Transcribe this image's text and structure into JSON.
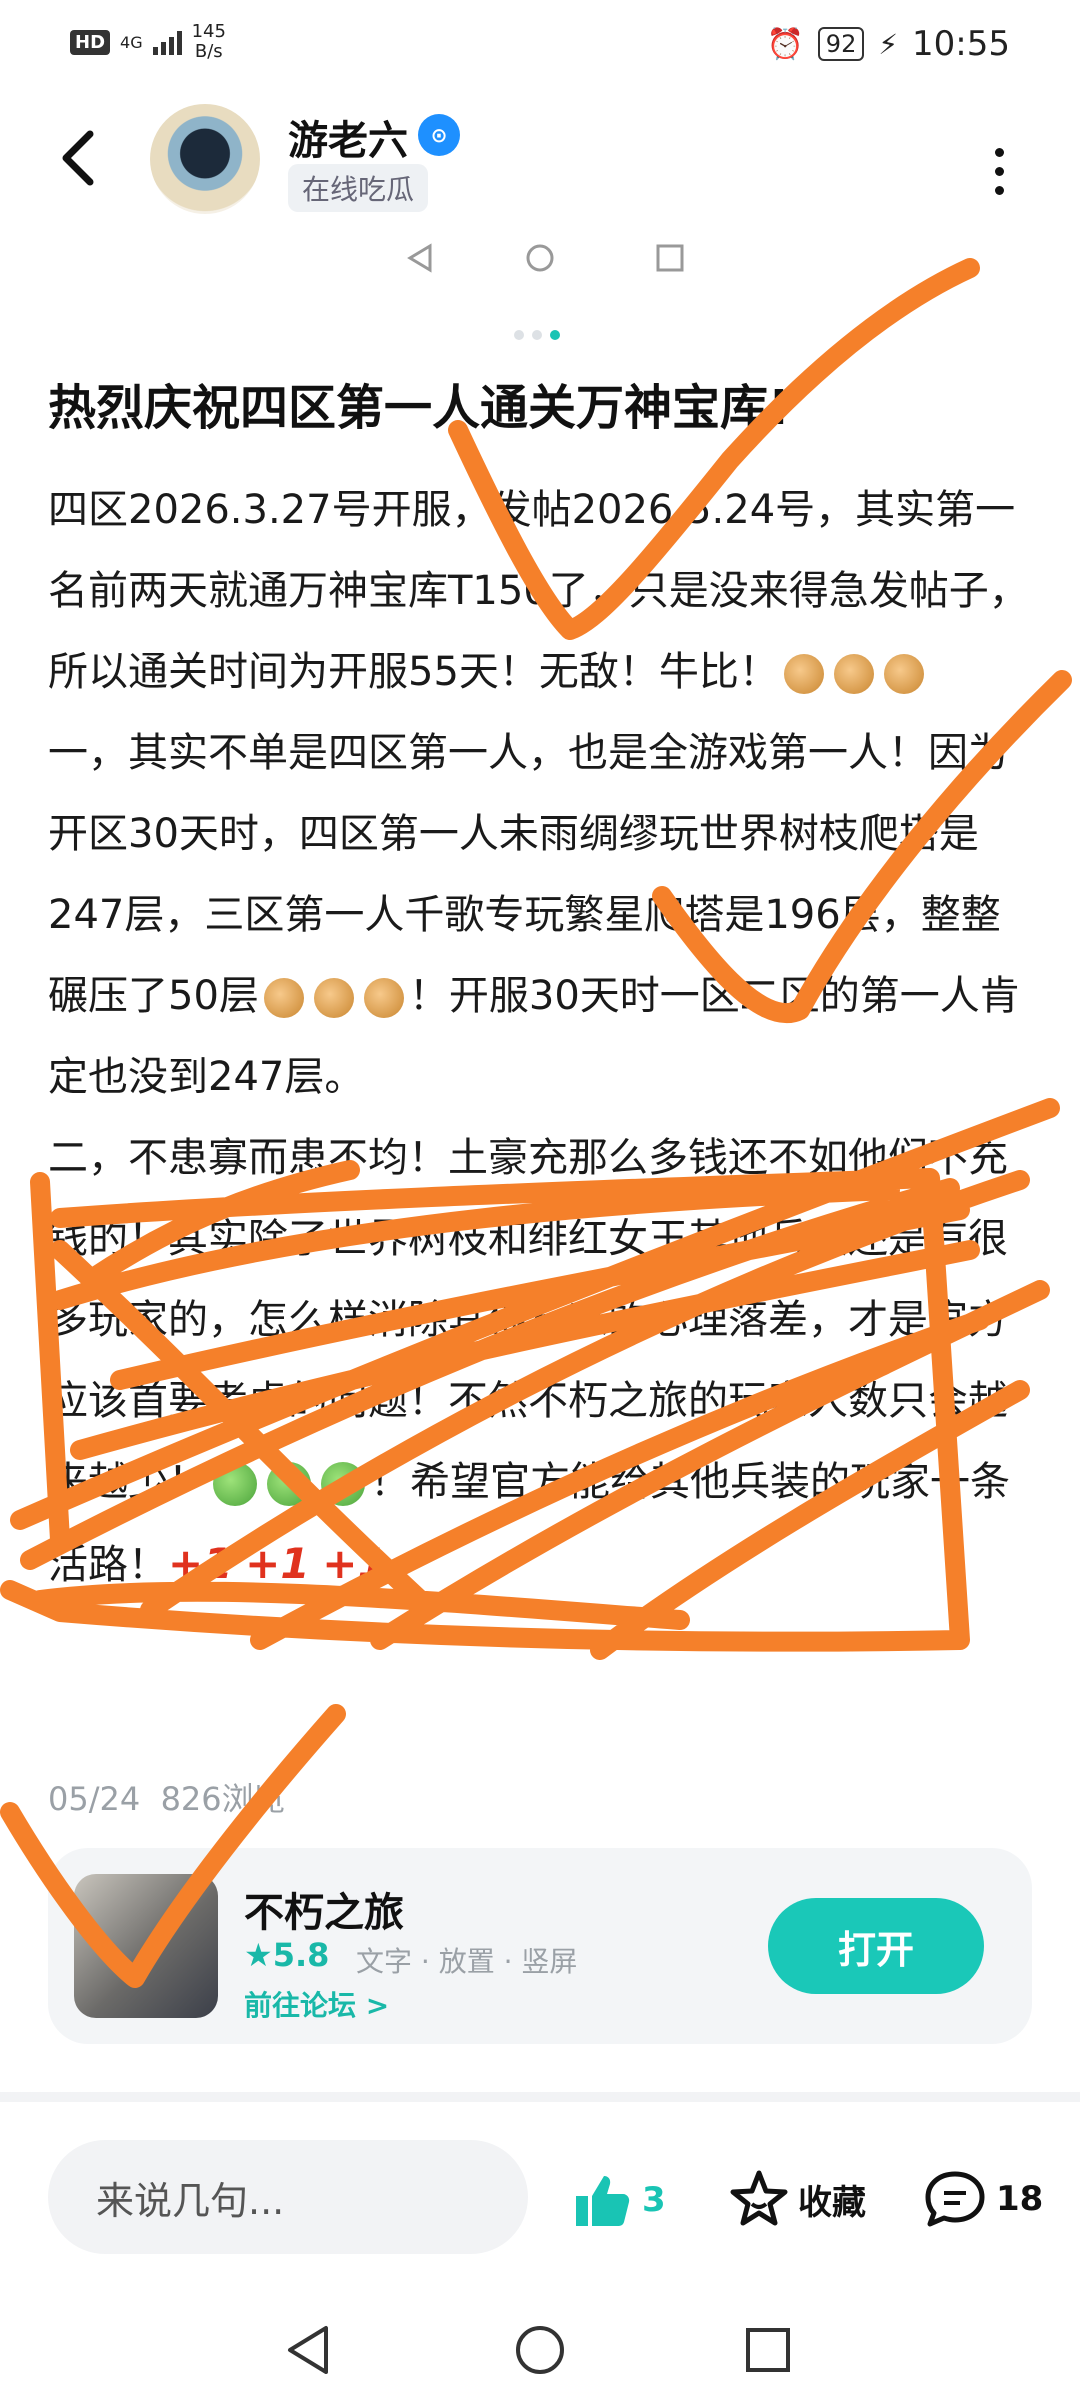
{
  "status_bar": {
    "hd": "HD",
    "network": "4G",
    "speed_value": "145",
    "speed_unit": "B/s",
    "battery": "92",
    "time": "10:55"
  },
  "header": {
    "username": "游老六",
    "user_tag": "在线吃瓜"
  },
  "post": {
    "title": "热烈庆祝四区第一人通关万神宝库!",
    "p1": "四区2026.3.27号开服，发帖2026.5.24号，其实第一名前两天就通万神宝库T150了，只是没来得急发帖子，所以通关时间为开服55天！无敌！牛比！",
    "p2a": "一，其实不单是四区第一人，也是全游戏第一人！因为开区30天时，四区第一人未雨绸缪玩世界树枝爬塔是247层，三区第一人千歌专玩繁星爬塔是196层，整整碾压了50层",
    "p2b": "！开服30天时一区二区的第一人肯定也没到247层。",
    "p3": "二，不患寡而患不均！土豪充那么多钱还不如他们不充钱的！其实除了世界树枝和绯红女王其他兵装还是有很多玩家的，怎么样消除其他玩家的心理落差，才是官方应该首要考虑的问题！不然不朽之旅的玩家人数只会越来越少！",
    "p3b": "！希望官方能给其他兵装的玩家一条活路！",
    "plus": "+1",
    "date": "05/24",
    "views": "826浏览"
  },
  "game_card": {
    "name": "不朽之旅",
    "rating": "5.8",
    "tags": "文字 · 放置 · 竖屏",
    "forum_link": "前往论坛 >",
    "open_button": "打开"
  },
  "bottom_bar": {
    "comment_placeholder": "来说几句...",
    "like_count": "3",
    "favorite_label": "收藏",
    "comment_count": "18"
  },
  "colors": {
    "accent": "#19c4b4",
    "scribble": "#f5802a",
    "plus_one": "#e0321e"
  }
}
